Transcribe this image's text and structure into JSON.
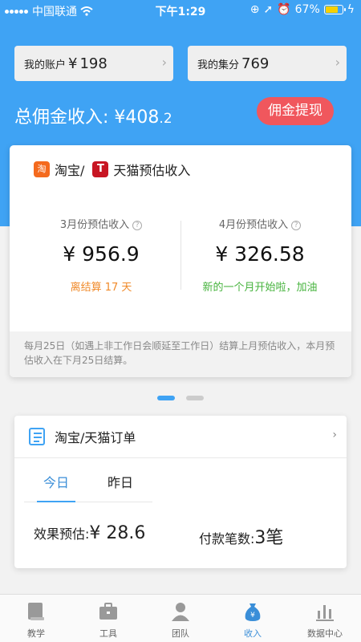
{
  "status": {
    "carrier": "中国联通",
    "time": "下午1:29",
    "battery": "67%"
  },
  "account": {
    "label": "我的账户",
    "currency": "¥",
    "value": "198"
  },
  "points": {
    "label": "我的集分",
    "value": "769"
  },
  "total": {
    "label": "总佣金收入:",
    "currency": "¥",
    "main": "408",
    "decimal": ".2"
  },
  "withdraw_label": "佣金提现",
  "estimate": {
    "taobao": "淘宝/",
    "tmall": "天猫预估收入",
    "tb_icon": "淘",
    "tm_icon": "T",
    "march": {
      "title": "3月份预估收入",
      "amount": "¥ 956.9",
      "sub": "离结算 17 天"
    },
    "april": {
      "title": "4月份预估收入",
      "amount": "¥ 326.58",
      "sub": "新的一个月开始啦，加油"
    },
    "note": "每月25日（如遇上非工作日会顺延至工作日）结算上月预估收入，本月预估收入在下月25日结算。"
  },
  "orders": {
    "title": "淘宝/天猫订单",
    "tabs": [
      "今日",
      "昨日"
    ],
    "effect_label": "效果预估:",
    "effect_value": "¥ 28.6",
    "payment_label": "付款笔数:",
    "payment_value": "3笔"
  },
  "nav": [
    {
      "label": "教学",
      "icon": "book-icon"
    },
    {
      "label": "工具",
      "icon": "toolbox-icon"
    },
    {
      "label": "团队",
      "icon": "team-icon"
    },
    {
      "label": "收入",
      "icon": "moneybag-icon"
    },
    {
      "label": "数据中心",
      "icon": "bar-chart-icon"
    }
  ],
  "colors": {
    "primary": "#3fa3f4",
    "withdraw": "#f0575d",
    "orange": "#f08a2a",
    "green": "#46b33d"
  }
}
